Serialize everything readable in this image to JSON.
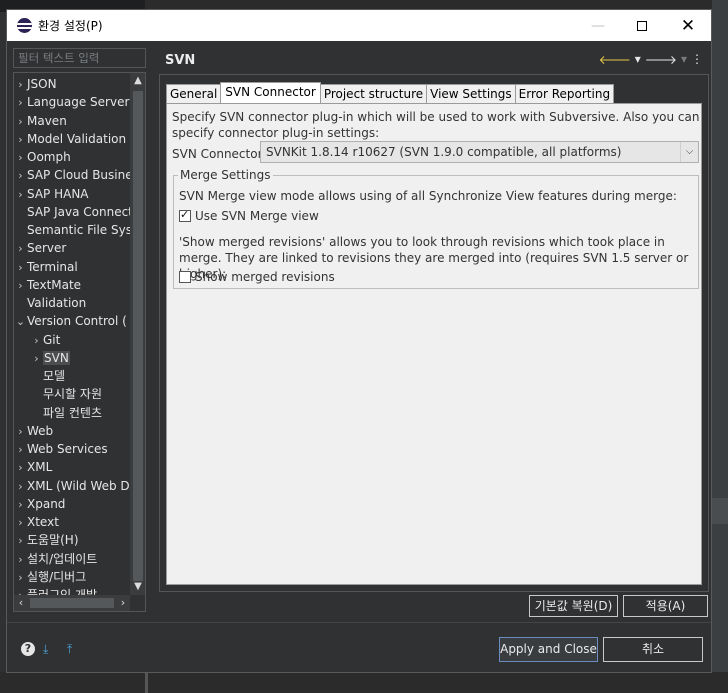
{
  "window": {
    "title": "환경 설정(P)"
  },
  "sidebar": {
    "filter_placeholder": "필터 텍스트 입력",
    "items": [
      {
        "label": "JSON",
        "level": 0,
        "expandable": true
      },
      {
        "label": "Language Servers",
        "level": 0,
        "expandable": true
      },
      {
        "label": "Maven",
        "level": 0,
        "expandable": true
      },
      {
        "label": "Model Validation",
        "level": 0,
        "expandable": true
      },
      {
        "label": "Oomph",
        "level": 0,
        "expandable": true
      },
      {
        "label": "SAP Cloud Busine",
        "level": 0,
        "expandable": true
      },
      {
        "label": "SAP HANA",
        "level": 0,
        "expandable": true
      },
      {
        "label": "SAP Java Connect",
        "level": 0,
        "expandable": false
      },
      {
        "label": "Semantic File Syst",
        "level": 0,
        "expandable": false
      },
      {
        "label": "Server",
        "level": 0,
        "expandable": true
      },
      {
        "label": "Terminal",
        "level": 0,
        "expandable": true
      },
      {
        "label": "TextMate",
        "level": 0,
        "expandable": true
      },
      {
        "label": "Validation",
        "level": 0,
        "expandable": false
      },
      {
        "label": "Version Control (",
        "level": 0,
        "expandable": true,
        "expanded": true
      },
      {
        "label": "Git",
        "level": 1,
        "expandable": true
      },
      {
        "label": "SVN",
        "level": 1,
        "expandable": true,
        "selected": true
      },
      {
        "label": "모델",
        "level": 1,
        "expandable": false
      },
      {
        "label": "무시할 자원",
        "level": 1,
        "expandable": false
      },
      {
        "label": "파일 컨텐츠",
        "level": 1,
        "expandable": false
      },
      {
        "label": "Web",
        "level": 0,
        "expandable": true
      },
      {
        "label": "Web Services",
        "level": 0,
        "expandable": true
      },
      {
        "label": "XML",
        "level": 0,
        "expandable": true
      },
      {
        "label": "XML (Wild Web D",
        "level": 0,
        "expandable": true
      },
      {
        "label": "Xpand",
        "level": 0,
        "expandable": true
      },
      {
        "label": "Xtext",
        "level": 0,
        "expandable": true
      },
      {
        "label": "도움말(H)",
        "level": 0,
        "expandable": true
      },
      {
        "label": "설치/업데이트",
        "level": 0,
        "expandable": true
      },
      {
        "label": "실행/디버그",
        "level": 0,
        "expandable": true
      },
      {
        "label": "플러그인 개발",
        "level": 0,
        "expandable": true
      }
    ]
  },
  "page": {
    "title": "SVN",
    "tabs": [
      "General",
      "SVN Connector",
      "Project structure",
      "View Settings",
      "Error Reporting"
    ],
    "active_tab": "SVN Connector",
    "description": "Specify SVN connector plug-in which will be used to work with Subversive. Also you can specify connector plug-in settings:",
    "connector_label": "SVN Connector:",
    "connector_value": "SVNKit 1.8.14 r10627 (SVN 1.9.0 compatible, all platforms)",
    "merge_group": {
      "title": "Merge Settings",
      "intro": "SVN Merge view mode allows using of all Synchronize View features during merge:",
      "use_merge_view_label": "Use SVN Merge view",
      "use_merge_view_checked": true,
      "show_merged_desc": "'Show merged revisions' allows you to look through revisions which took place in merge. They are linked to revisions they are merged into (requires SVN 1.5 server or higher):",
      "show_merged_label": "Show merged revisions",
      "show_merged_checked": false
    }
  },
  "buttons": {
    "restore_defaults": "기본값 복원(D)",
    "apply": "적용(A)",
    "apply_and_close": "Apply and Close",
    "cancel": "취소"
  }
}
